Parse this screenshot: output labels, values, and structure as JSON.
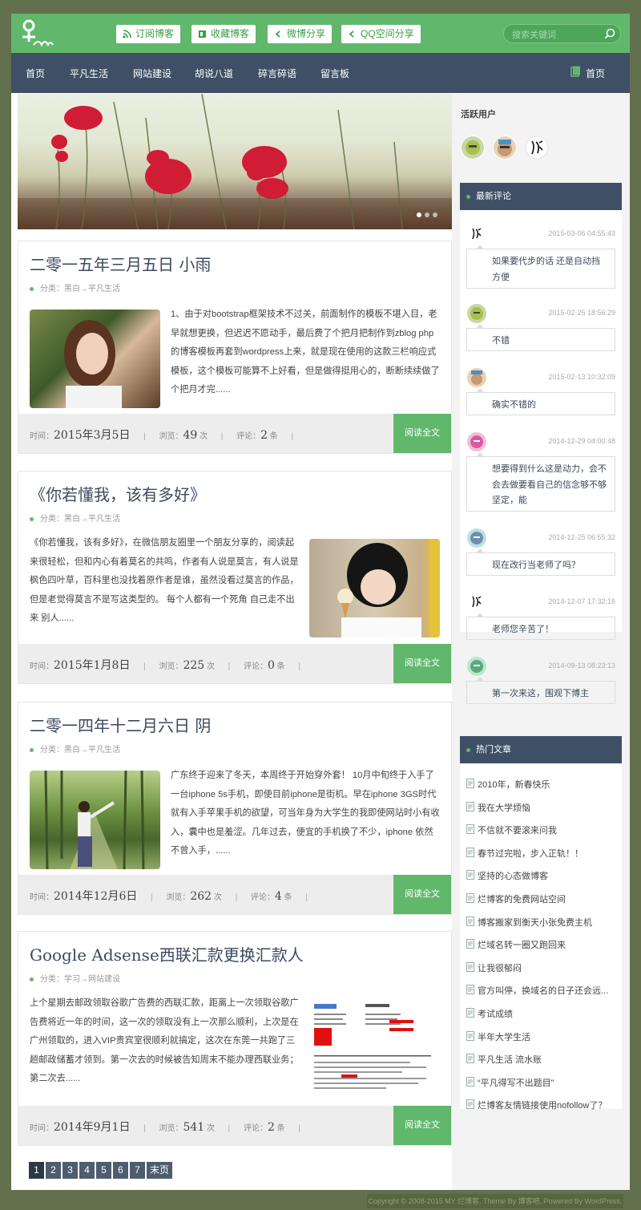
{
  "header": {
    "share_buttons": [
      "订阅博客",
      "收藏博客",
      "微博分享",
      "QQ空间分享"
    ],
    "search_placeholder": "搜索关键词"
  },
  "nav": {
    "items": [
      "首页",
      "平凡生活",
      "网站建设",
      "胡说八道",
      "碎言碎语",
      "留言板"
    ],
    "right_home": "首页"
  },
  "posts": [
    {
      "title": "二零一五年三月五日 小雨",
      "category": "分类：黑白→平凡生活",
      "excerpt": "1、由于对bootstrap框架技术不过关，前面制作的模板不堪入目，老早就想更换，但迟迟不愿动手，最后费了个把月把制作到zblog php的博客模板再套到wordpress上来，就是现在使用的这款三栏响应式模板，这个模板可能算不上好看，但是做得挺用心的，断断续续做了个把月才完......",
      "time_label": "时间：",
      "date": "2015年3月5日",
      "views_label": "浏览：",
      "views": "49",
      "views_unit": "次",
      "comments_label": "评论：",
      "comments": "2",
      "comments_unit": "条",
      "read_more": "阅读全文"
    },
    {
      "title": "《你若懂我，该有多好》",
      "category": "分类：黑白→平凡生活",
      "excerpt": "《你若懂我，该有多好》，在微信朋友圈里一个朋友分享的，阅读起来很轻松，但和内心有着莫名的共鸣，作者有人说是莫言，有人说是枫色四叶草，百科里也没找着原作者是谁，虽然没看过莫言的作品，但是老觉得莫言不是写这类型的。 每个人都有一个死角 自己走不出来 别人......",
      "time_label": "时间：",
      "date": "2015年1月8日",
      "views_label": "浏览：",
      "views": "225",
      "views_unit": "次",
      "comments_label": "评论：",
      "comments": "0",
      "comments_unit": "条",
      "read_more": "阅读全文"
    },
    {
      "title": "二零一四年十二月六日 阴",
      "category": "分类：黑白→平凡生活",
      "excerpt": "广东终于迎来了冬天，本周终于开始穿外套！ 10月中旬终于入手了一台iphone 5s手机，即使目前iphone是街机。早在iphone 3GS时代就有入手苹果手机的欲望，可当年身为大学生的我即使网站时小有收入，囊中也是羞涩。几年过去，便宜的手机换了不少，iphone 依然不曾入手，......",
      "time_label": "时间：",
      "date": "2014年12月6日",
      "views_label": "浏览：",
      "views": "262",
      "views_unit": "次",
      "comments_label": "评论：",
      "comments": "4",
      "comments_unit": "条",
      "read_more": "阅读全文"
    },
    {
      "title": "Google Adsense西联汇款更换汇款人",
      "category": "分类：学习→网站建设",
      "excerpt": "上个星期去邮政领取谷歌广告费的西联汇款，距离上一次领取谷歌广告费将近一年的时间，这一次的领取没有上一次那么顺利，上次是在广州领取的，进入VIP贵宾室很顺利就搞定，这次在东莞一共跑了三趟邮政储蓄才领到。第一次去的时候被告知周末不能办理西联业务；第二次去......",
      "time_label": "时间：",
      "date": "2014年9月1日",
      "views_label": "浏览：",
      "views": "541",
      "views_unit": "次",
      "comments_label": "评论：",
      "comments": "2",
      "comments_unit": "条",
      "read_more": "阅读全文"
    }
  ],
  "pager": [
    "1",
    "2",
    "3",
    "4",
    "5",
    "6",
    "7",
    "末页"
  ],
  "sidebar": {
    "active_users_title": "活跃用户",
    "recent_comments_title": "最新评论",
    "comments": [
      {
        "date": "2015-03-06 04:55:43",
        "text": "如果要代步的话 还是自动挡方便"
      },
      {
        "date": "2015-02-25 18:56:29",
        "text": "不错"
      },
      {
        "date": "2015-02-13 10:32:09",
        "text": "确实不错的"
      },
      {
        "date": "2014-12-29 04:00:48",
        "text": "想要得到什么这是动力，会不会去做要看自己的信念够不够坚定，能"
      },
      {
        "date": "2014-12-25 06:55:32",
        "text": "现在改行当老师了吗？"
      },
      {
        "date": "2014-12-07 17:32:16",
        "text": "老师您辛苦了！"
      },
      {
        "date": "2014-09-13 08:23:13",
        "text": "第一次来这，围观下博主"
      }
    ],
    "hot_title": "热门文章",
    "hot_posts": [
      "2010年，新春快乐",
      "我在大学烦恼",
      "不信就不要滚来问我",
      "春节过完啦，步入正轨！！",
      "坚持的心态做博客",
      "烂博客的免费网站空间",
      "博客搬家到衡天小张免费主机",
      "烂域名转一圈又跑回来",
      "让我很郁闷",
      "官方叫停，换域名的日子还会远...",
      "考试成绩",
      "半年大学生活",
      "平凡生活 流水账",
      "“平凡得写不出题目”",
      "烂博客友情链接使用nofollow了？"
    ]
  },
  "footer": "Copyright © 2008-2015 MY 烂博客. Theme By 博客吧. Powered By WordPress."
}
